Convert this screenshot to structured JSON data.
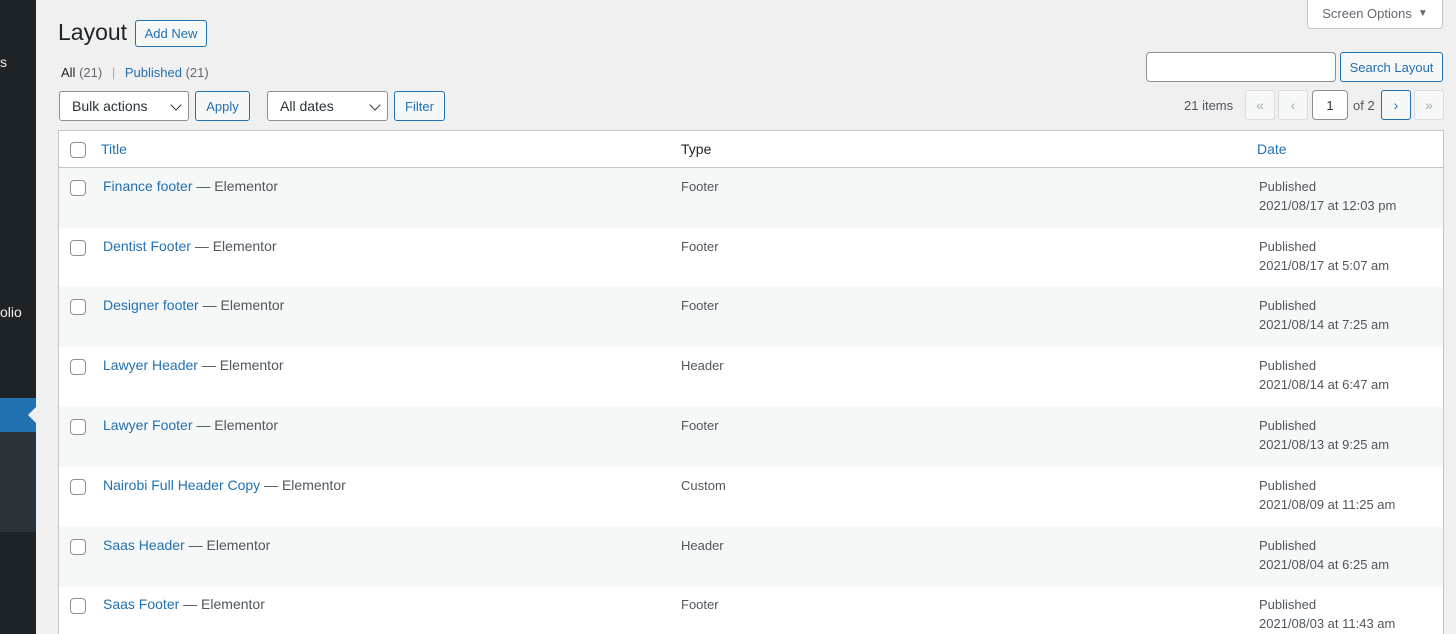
{
  "sidebar": {
    "fragments": [
      "s",
      "olio"
    ]
  },
  "header": {
    "screen_options": "Screen Options",
    "title": "Layout",
    "add_new": "Add New"
  },
  "views": {
    "all_label": "All",
    "all_count": "(21)",
    "sep": "|",
    "published_label": "Published",
    "published_count": "(21)"
  },
  "search": {
    "button": "Search Layout",
    "value": ""
  },
  "tablenav": {
    "bulk_actions": "Bulk actions",
    "apply": "Apply",
    "dates": "All dates",
    "filter": "Filter",
    "items": "21 items",
    "first": "«",
    "prev": "‹",
    "current_page": "1",
    "of_pages": "of 2",
    "next": "›",
    "last": "»"
  },
  "table": {
    "columns": {
      "title": "Title",
      "type": "Type",
      "date": "Date"
    },
    "rows": [
      {
        "title": "Finance footer",
        "suffix": " — Elementor",
        "type": "Footer",
        "status": "Published",
        "date": "2021/08/17 at 12:03 pm"
      },
      {
        "title": "Dentist Footer",
        "suffix": " — Elementor",
        "type": "Footer",
        "status": "Published",
        "date": "2021/08/17 at 5:07 am"
      },
      {
        "title": "Designer footer",
        "suffix": " — Elementor",
        "type": "Footer",
        "status": "Published",
        "date": "2021/08/14 at 7:25 am"
      },
      {
        "title": "Lawyer Header",
        "suffix": " — Elementor",
        "type": "Header",
        "status": "Published",
        "date": "2021/08/14 at 6:47 am"
      },
      {
        "title": "Lawyer Footer",
        "suffix": " — Elementor",
        "type": "Footer",
        "status": "Published",
        "date": "2021/08/13 at 9:25 am"
      },
      {
        "title": "Nairobi Full Header Copy",
        "suffix": " — Elementor",
        "type": "Custom",
        "status": "Published",
        "date": "2021/08/09 at 11:25 am"
      },
      {
        "title": "Saas Header",
        "suffix": " — Elementor",
        "type": "Header",
        "status": "Published",
        "date": "2021/08/04 at 6:25 am"
      },
      {
        "title": "Saas Footer",
        "suffix": " — Elementor",
        "type": "Footer",
        "status": "Published",
        "date": "2021/08/03 at 11:43 am"
      }
    ]
  }
}
